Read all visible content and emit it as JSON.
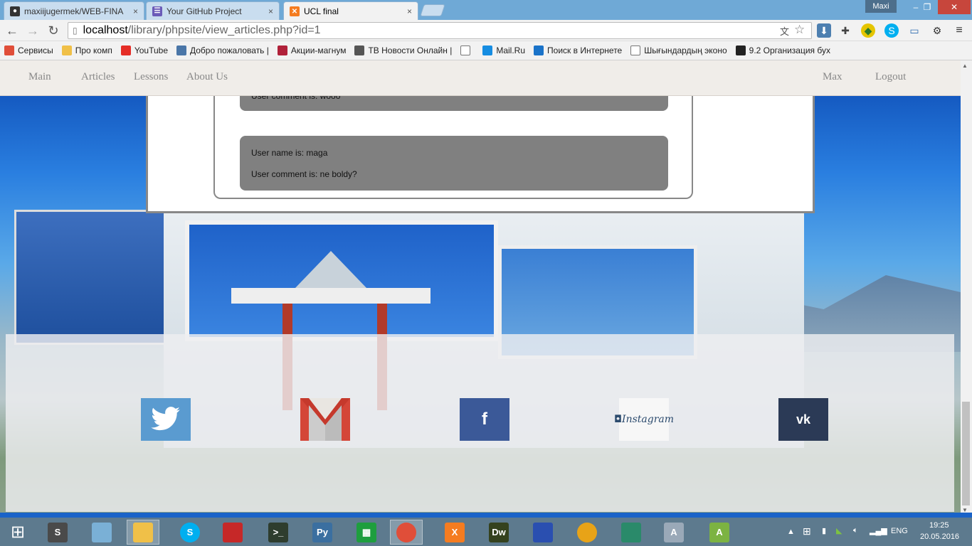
{
  "browser": {
    "tabs": [
      {
        "title": "maxiijugermek/WEB-FINA",
        "icon": "github-icon",
        "color": "#333333"
      },
      {
        "title": "Your GitHub Project",
        "icon": "project-icon",
        "color": "#6b5bb8"
      },
      {
        "title": "UCL final",
        "icon": "xampp-icon",
        "color": "#f57c20"
      }
    ],
    "tab_close": "×",
    "user_badge": "Maxi",
    "window_buttons": {
      "minimize": "–",
      "restore": "❐",
      "close": "✕"
    },
    "url_host": "localhost",
    "url_path": "/library/phpsite/view_articles.php?id=1",
    "nav_icons": {
      "back": "←",
      "forward": "→",
      "reload": "↻"
    },
    "bookmarks": [
      {
        "label": "Сервисы",
        "icon": "apps-grid-icon",
        "color": "#e04e39"
      },
      {
        "label": "Про комп",
        "icon": "folder-icon",
        "color": "#f0c048"
      },
      {
        "label": "YouTube",
        "icon": "youtube-icon",
        "color": "#e52d27"
      },
      {
        "label": "Добро пожаловать |",
        "icon": "vk-icon",
        "color": "#4a76a8"
      },
      {
        "label": "Акции-магнум",
        "icon": "magnum-icon",
        "color": "#b0213a"
      },
      {
        "label": "ТВ Новости Онлайн |",
        "icon": "tv-icon",
        "color": "#555555"
      },
      {
        "label": "",
        "icon": "page-icon",
        "color": "#ffffff"
      },
      {
        "label": "Mail.Ru",
        "icon": "mailru-icon",
        "color": "#168de2"
      },
      {
        "label": "Поиск в Интернете",
        "icon": "search-icon",
        "color": "#1a73c9"
      },
      {
        "label": "Шығындардың эконо",
        "icon": "page-icon",
        "color": "#ffffff"
      },
      {
        "label": "9.2 Организация бух",
        "icon": "ball-icon",
        "color": "#222222"
      }
    ]
  },
  "nav": {
    "left": [
      "Main",
      "Articles",
      "Lessons",
      "About Us"
    ],
    "user": "Max",
    "logout": "Logout"
  },
  "comments": [
    {
      "name_line": "",
      "comment_line": "User comment is: wooo"
    },
    {
      "name_line": "User name is: maga",
      "comment_line": "User comment is: ne boldy?"
    }
  ],
  "footer": {
    "social": [
      {
        "name": "twitter",
        "icon": "twitter-icon",
        "color": "#4a90c8"
      },
      {
        "name": "gmail",
        "icon": "gmail-icon",
        "color": "#d44638"
      },
      {
        "name": "facebook",
        "icon": "facebook-icon",
        "color": "#3b5998",
        "glyph": "f"
      },
      {
        "name": "instagram",
        "icon": "instagram-icon",
        "color": "#ffffff",
        "text": "Instagram"
      },
      {
        "name": "vk",
        "icon": "vk-icon",
        "color": "#2b3a56",
        "glyph": "vk"
      }
    ]
  },
  "taskbar": {
    "apps": [
      {
        "name": "sublime",
        "icon": "sublime-icon",
        "color": "#4a4a4a",
        "glyph": "S"
      },
      {
        "name": "notepad",
        "icon": "notepad-icon",
        "color": "#7ab0d6",
        "glyph": ""
      },
      {
        "name": "explorer",
        "icon": "folder-icon",
        "color": "#f0c048",
        "glyph": ""
      },
      {
        "name": "skype",
        "icon": "skype-icon",
        "color": "#00aff0",
        "glyph": "S"
      },
      {
        "name": "book",
        "icon": "book-icon",
        "color": "#c62828",
        "glyph": ""
      },
      {
        "name": "terminal",
        "icon": "terminal-icon",
        "color": "#2e3d2e",
        "glyph": ">_"
      },
      {
        "name": "python",
        "icon": "python-icon",
        "color": "#3b6fa0",
        "glyph": "Py"
      },
      {
        "name": "calculator",
        "icon": "calculator-icon",
        "color": "#1e9e3e",
        "glyph": "▦"
      },
      {
        "name": "chrome",
        "icon": "chrome-icon",
        "color": "#e04e39",
        "glyph": ""
      },
      {
        "name": "xampp",
        "icon": "xampp-icon",
        "color": "#f57c20",
        "glyph": "X"
      },
      {
        "name": "dreamweaver",
        "icon": "dreamweaver-icon",
        "color": "#35421e",
        "glyph": "Dw"
      },
      {
        "name": "save",
        "icon": "floppy-icon",
        "color": "#2a4fb0",
        "glyph": ""
      },
      {
        "name": "rainbow",
        "icon": "ball-icon",
        "color": "#e8a317",
        "glyph": ""
      },
      {
        "name": "tool",
        "icon": "tool-icon",
        "color": "#2a8a6a",
        "glyph": ""
      },
      {
        "name": "abbyy",
        "icon": "abbyy-icon",
        "color": "#9aa9b8",
        "glyph": "A"
      },
      {
        "name": "android",
        "icon": "android-studio-icon",
        "color": "#7cb342",
        "glyph": "A"
      }
    ],
    "lang": "ENG",
    "time": "19:25",
    "date": "20.05.2016"
  }
}
